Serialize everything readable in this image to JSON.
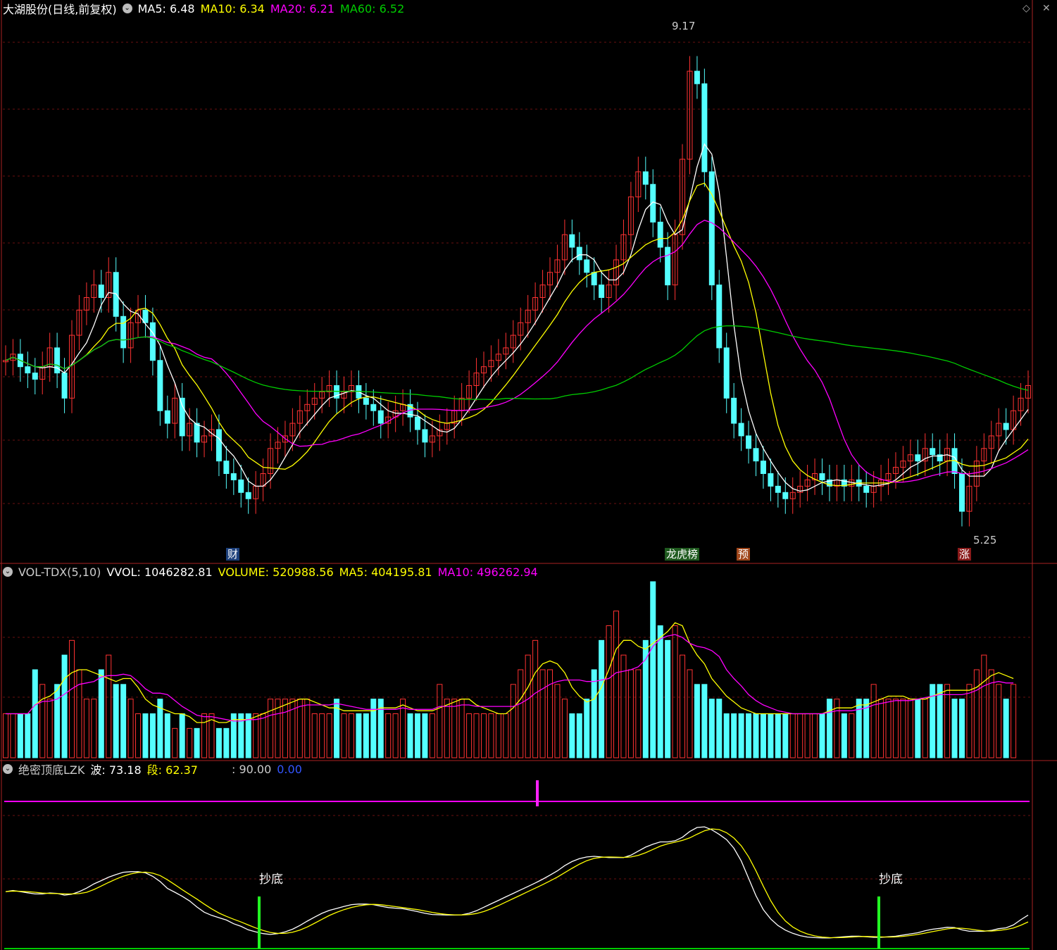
{
  "price_panel": {
    "title": "大湖股份(日线,前复权)",
    "ma5_label": "MA5: 6.48",
    "ma10_label": "MA10: 6.34",
    "ma20_label": "MA20: 6.21",
    "ma60_label": "MA60: 6.52",
    "high_label": "9.17",
    "low_label": "5.25",
    "marker_cai": "财",
    "marker_longhu": "龙虎榜",
    "marker_yu": "预",
    "marker_zhang": "涨",
    "colors": {
      "ma5": "#ffffff",
      "ma10": "#ffff00",
      "ma20": "#ff00ff",
      "ma60": "#00cc00",
      "up": "#ff3232",
      "down": "#54ffff"
    }
  },
  "volume_panel": {
    "title": "VOL-TDX(5,10)",
    "vvol_label": "VVOL: 1046282.81",
    "volume_label": "VOLUME: 520988.56",
    "ma5_label": "MA5: 404195.81",
    "ma10_label": "MA10: 496262.94"
  },
  "indicator_panel": {
    "title": "绝密顶底LZK",
    "bo_label": "波: 73.18",
    "duan_label": "段: 62.37",
    "level_label": ": 90.00",
    "zero_label": "0.00",
    "signal_1": "抄底",
    "signal_2": "抄底"
  },
  "window_controls": {
    "diamond_icon": "◇",
    "close_icon": "✕"
  },
  "chart_data": {
    "type": "line",
    "price_range": [
      5.25,
      9.17
    ],
    "osc_range": [
      0,
      100
    ],
    "closes": [
      6.5,
      6.55,
      6.45,
      6.4,
      6.35,
      6.45,
      6.6,
      6.4,
      6.2,
      6.7,
      6.9,
      7.0,
      7.1,
      7.0,
      7.2,
      6.85,
      6.6,
      6.8,
      6.9,
      6.8,
      6.5,
      6.1,
      6.0,
      6.2,
      5.9,
      6.0,
      5.85,
      5.9,
      5.95,
      5.7,
      5.6,
      5.55,
      5.45,
      5.4,
      5.5,
      5.6,
      5.8,
      5.85,
      5.9,
      6.0,
      6.1,
      6.15,
      6.2,
      6.25,
      6.3,
      6.2,
      6.25,
      6.3,
      6.2,
      6.15,
      6.1,
      6.0,
      6.05,
      6.1,
      6.15,
      6.05,
      5.95,
      5.85,
      5.9,
      5.95,
      6.0,
      6.1,
      6.2,
      6.3,
      6.4,
      6.45,
      6.5,
      6.55,
      6.6,
      6.7,
      6.8,
      6.9,
      7.0,
      7.1,
      7.2,
      7.3,
      7.5,
      7.4,
      7.3,
      7.2,
      7.1,
      7.0,
      7.1,
      7.3,
      7.5,
      7.8,
      8.0,
      7.9,
      7.6,
      7.4,
      7.1,
      7.5,
      8.1,
      8.8,
      8.7,
      8.0,
      7.1,
      6.6,
      6.2,
      6.0,
      5.9,
      5.8,
      5.7,
      5.6,
      5.5,
      5.45,
      5.4,
      5.45,
      5.5,
      5.55,
      5.6,
      5.55,
      5.5,
      5.55,
      5.5,
      5.55,
      5.5,
      5.45,
      5.5,
      5.55,
      5.6,
      5.65,
      5.7,
      5.75,
      5.7,
      5.8,
      5.75,
      5.7,
      5.8,
      5.6,
      5.3,
      5.5,
      5.7,
      5.8,
      5.9,
      6.0,
      5.95,
      6.1,
      6.2,
      6.3
    ],
    "volumes": [
      3,
      3,
      3,
      3,
      6,
      5,
      4,
      5,
      7,
      8,
      6,
      4,
      4,
      6,
      7,
      5,
      5,
      4,
      3,
      3,
      3,
      4,
      3,
      2,
      3,
      2,
      2,
      3,
      3,
      2,
      2,
      3,
      3,
      3,
      3,
      3,
      4,
      4,
      4,
      4,
      4,
      4,
      3,
      3,
      3,
      4,
      3,
      3,
      3,
      3,
      4,
      4,
      3,
      3,
      4,
      3,
      3,
      3,
      3,
      5,
      4,
      4,
      4,
      3,
      3,
      3,
      3,
      3,
      3,
      5,
      6,
      7,
      8,
      6,
      6,
      5,
      4,
      3,
      3,
      4,
      6,
      8,
      9,
      10,
      7,
      6,
      6,
      8,
      12,
      9,
      8,
      9,
      7,
      6,
      5,
      5,
      4,
      4,
      3,
      3,
      3,
      3,
      3,
      3,
      3,
      3,
      3,
      3,
      3,
      3,
      3,
      3,
      4,
      4,
      3,
      3,
      4,
      4,
      5,
      4,
      4,
      4,
      4,
      4,
      4,
      4,
      5,
      5,
      5,
      4,
      4,
      5,
      6,
      7,
      6,
      5,
      4,
      5
    ]
  }
}
